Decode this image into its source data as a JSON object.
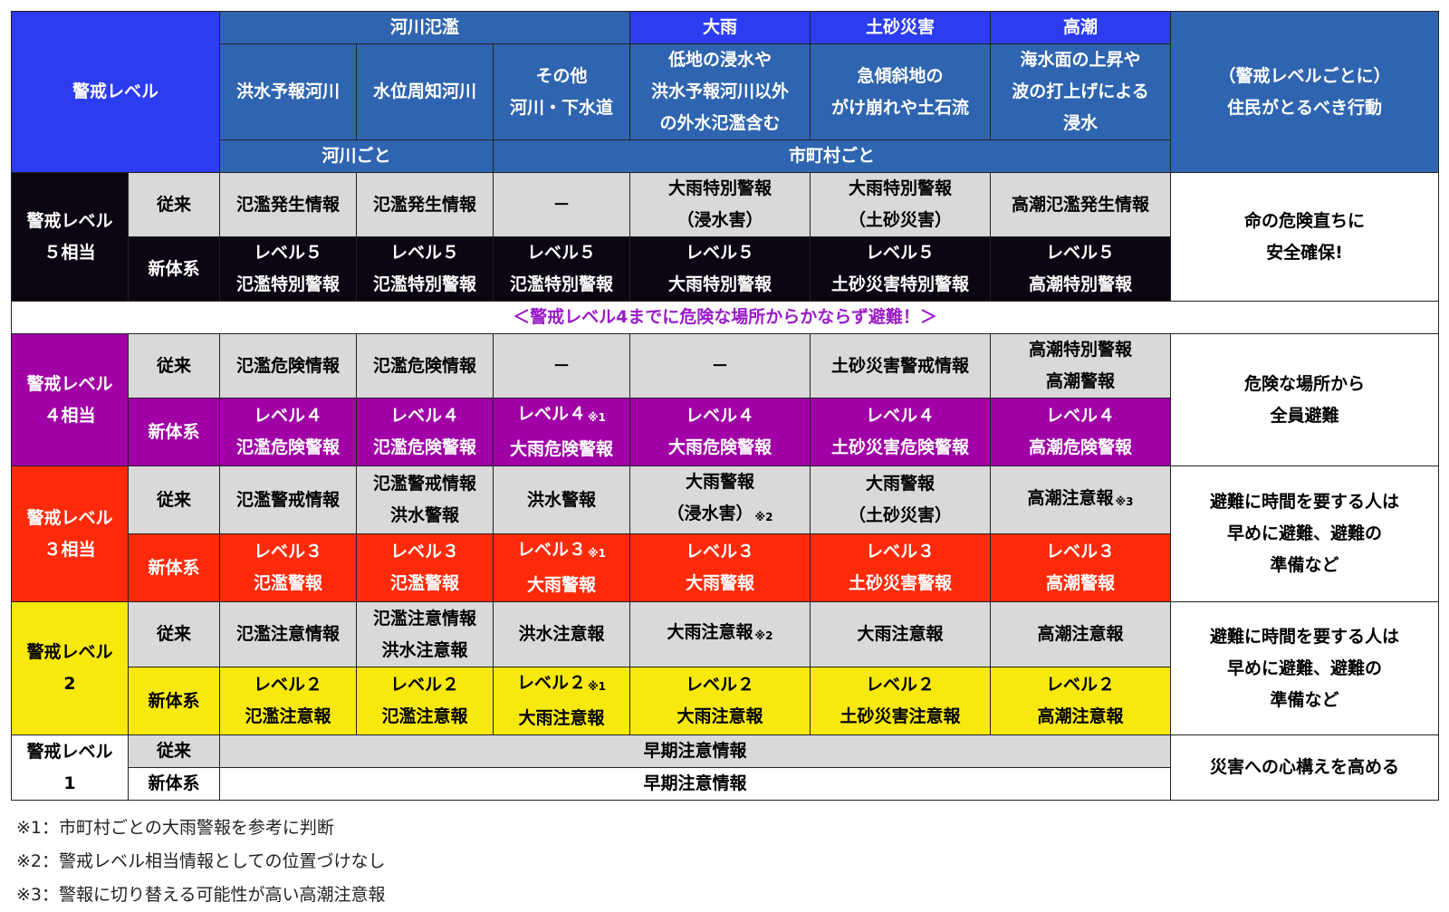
{
  "header": {
    "level_label": "警戒レベル",
    "groups": {
      "river": "河川氾濫",
      "heavy_rain": "大雨",
      "landslide": "土砂災害",
      "storm_surge": "高潮"
    },
    "sub": {
      "flood_forecast_river": "洪水予報河川",
      "water_level_river": "水位周知河川",
      "other_line1": "その他",
      "other_line2": "河川・下水道",
      "rain_line1": "低地の浸水や",
      "rain_line2": "洪水予報河川以外",
      "rain_line3": "の外水氾濫含む",
      "slide_line1": "急傾斜地の",
      "slide_line2": "がけ崩れや土石流",
      "surge_line1": "海水面の上昇や",
      "surge_line2": "波の打上げによる",
      "surge_line3": "浸水"
    },
    "scope": {
      "per_river": "河川ごと",
      "per_municipality": "市町村ごと"
    },
    "action_line1": "（警戒レベルごとに）",
    "action_line2": "住民がとるべき行動"
  },
  "row_types": {
    "old": "従来",
    "new": "新体系"
  },
  "level5": {
    "label_line1": "警戒レベル",
    "label_line2": "５相当",
    "old": [
      "氾濫発生情報",
      "氾濫発生情報",
      "－",
      "大雨特別警報",
      "大雨特別警報",
      "高潮氾濫発生情報"
    ],
    "old_second": [
      "",
      "",
      "",
      "（浸水害）",
      "（土砂災害）",
      ""
    ],
    "new_level": [
      "レベル５",
      "レベル５",
      "レベル５",
      "レベル５",
      "レベル５",
      "レベル５"
    ],
    "new_name": [
      "氾濫特別警報",
      "氾濫特別警報",
      "氾濫特別警報",
      "大雨特別警報",
      "土砂災害特別警報",
      "高潮特別警報"
    ],
    "action_line1": "命の危険直ちに",
    "action_line2": "安全確保!"
  },
  "banner": "＜警戒レベル4までに危険な場所からかならず避難！＞",
  "level4": {
    "label_line1": "警戒レベル",
    "label_line2": "４相当",
    "old": [
      "氾濫危険情報",
      "氾濫危険情報",
      "－",
      "－",
      "土砂災害警戒情報",
      "高潮特別警報"
    ],
    "old_second": [
      "",
      "",
      "",
      "",
      "",
      "高潮警報"
    ],
    "new_level": [
      "レベル４",
      "レベル４",
      "レベル４",
      "レベル４",
      "レベル４",
      "レベル４"
    ],
    "new_note": [
      "",
      "",
      "※1",
      "",
      "",
      ""
    ],
    "new_name": [
      "氾濫危険警報",
      "氾濫危険警報",
      "大雨危険警報",
      "大雨危険警報",
      "土砂災害危険警報",
      "高潮危険警報"
    ],
    "action_line1": "危険な場所から",
    "action_line2": "全員避難"
  },
  "level3": {
    "label_line1": "警戒レベル",
    "label_line2": "３相当",
    "old": [
      "氾濫警戒情報",
      "氾濫警戒情報",
      "洪水警報",
      "大雨警報",
      "大雨警報",
      "高潮注意報"
    ],
    "old_second": [
      "",
      "洪水警報",
      "",
      "（浸水害）",
      "（土砂災害）",
      ""
    ],
    "old_note": [
      "",
      "",
      "",
      "※2",
      "",
      "※3"
    ],
    "new_level": [
      "レベル３",
      "レベル３",
      "レベル３",
      "レベル３",
      "レベル３",
      "レベル３"
    ],
    "new_note": [
      "",
      "",
      "※1",
      "",
      "",
      ""
    ],
    "new_name": [
      "氾濫警報",
      "氾濫警報",
      "大雨警報",
      "大雨警報",
      "土砂災害警報",
      "高潮警報"
    ],
    "action_line1": "避難に時間を要する人は",
    "action_line2": "早めに避難、避難の",
    "action_line3": "準備など"
  },
  "level2": {
    "label_line1": "警戒レベル",
    "label_line2": "2",
    "old": [
      "氾濫注意情報",
      "氾濫注意情報",
      "洪水注意報",
      "大雨注意報",
      "大雨注意報",
      "高潮注意報"
    ],
    "old_second": [
      "",
      "洪水注意報",
      "",
      "",
      "",
      ""
    ],
    "old_note": [
      "",
      "",
      "",
      "※2",
      "",
      ""
    ],
    "new_level": [
      "レベル２",
      "レベル２",
      "レベル２",
      "レベル２",
      "レベル２",
      "レベル２"
    ],
    "new_note": [
      "",
      "",
      "※1",
      "",
      "",
      ""
    ],
    "new_name": [
      "氾濫注意報",
      "氾濫注意報",
      "大雨注意報",
      "大雨注意報",
      "土砂災害注意報",
      "高潮注意報"
    ],
    "action_line1": "避難に時間を要する人は",
    "action_line2": "早めに避難、避難の",
    "action_line3": "準備など"
  },
  "level1": {
    "label_line1": "警戒レベル",
    "label_line2": "1",
    "old": "早期注意情報",
    "new": "早期注意情報",
    "action": "災害への心構えを高める"
  },
  "footnotes": [
    "※1：市町村ごとの大雨警報を参考に判断",
    "※2：警戒レベル相当情報としての位置づけなし",
    "※3：警報に切り替える可能性が高い高潮注意報"
  ],
  "colors": {
    "header_band": "#2f65b0",
    "header_accent": "#2c3cf0",
    "old_row": "#d9d9d9",
    "level5": "#0b0612",
    "level4": "#a000a6",
    "level3": "#ff2a0a",
    "level2": "#f7e80e",
    "banner_text": "#9b1bc8"
  }
}
